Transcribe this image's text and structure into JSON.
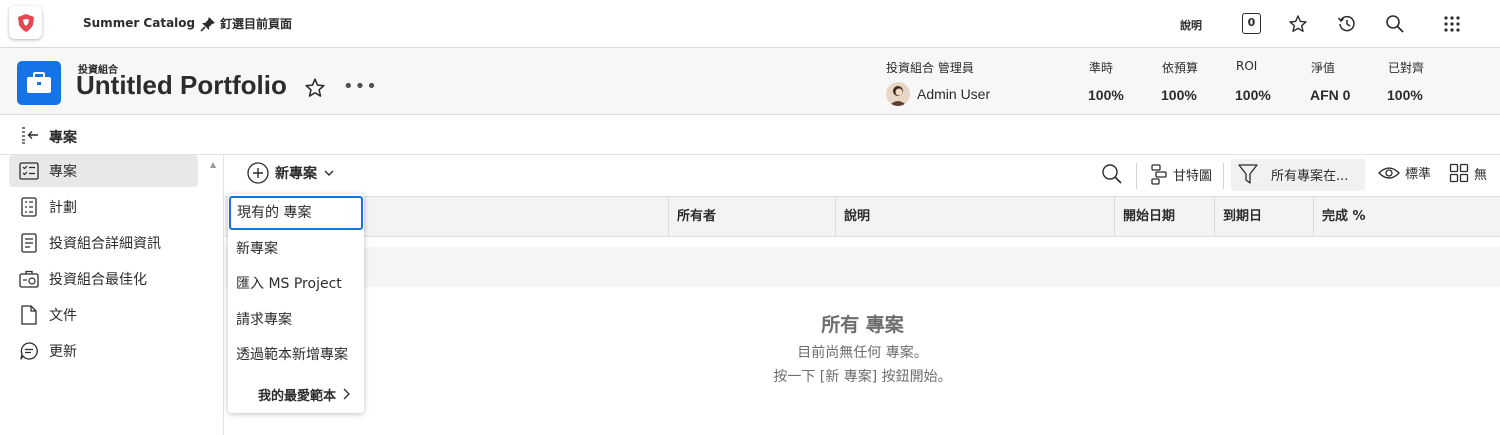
{
  "topbar": {
    "catalog_label": "Summer Catalog",
    "pin_label": "釘選目前頁面",
    "help_label": "說明",
    "notification_count": "0"
  },
  "header": {
    "kicker": "投資組合",
    "title": "Untitled Portfolio",
    "more_label": "•••",
    "manager_label": "投資組合 管理員",
    "manager_name": "Admin User",
    "metrics": [
      {
        "label": "準時",
        "value": "100%"
      },
      {
        "label": "依預算",
        "value": "100%"
      },
      {
        "label": "ROI",
        "value": "100%"
      },
      {
        "label": "淨值",
        "value": "AFN 0"
      },
      {
        "label": "已對齊",
        "value": "100%"
      }
    ]
  },
  "collapse": {
    "label": "專案"
  },
  "sidebar": {
    "items": [
      {
        "label": "專案",
        "icon": "projects-icon",
        "active": true
      },
      {
        "label": "計劃",
        "icon": "plan-icon"
      },
      {
        "label": "投資組合詳細資訊",
        "icon": "details-icon"
      },
      {
        "label": "投資組合最佳化",
        "icon": "optimizer-icon"
      },
      {
        "label": "文件",
        "icon": "document-icon"
      },
      {
        "label": "更新",
        "icon": "updates-icon"
      }
    ]
  },
  "toolbar": {
    "new_label": "新專案",
    "gantt_label": "甘特圖",
    "filter_label": "所有專案在...",
    "view_label": "標準",
    "group_label": "無"
  },
  "table": {
    "columns": [
      "所有者",
      "說明",
      "開始日期",
      "到期日",
      "完成 %"
    ]
  },
  "empty_state": {
    "title": "所有 專案",
    "line1": "目前尚無任何 專案。",
    "line2": "按一下 [新 專案] 按鈕開始。"
  },
  "menu": {
    "items": [
      "現有的 專案",
      "新專案",
      "匯入 MS Project",
      "請求專案",
      "透過範本新增專案"
    ],
    "favorites_label": "我的最愛範本"
  },
  "colors": {
    "accent": "#1473e6",
    "logo": "#e34850"
  }
}
